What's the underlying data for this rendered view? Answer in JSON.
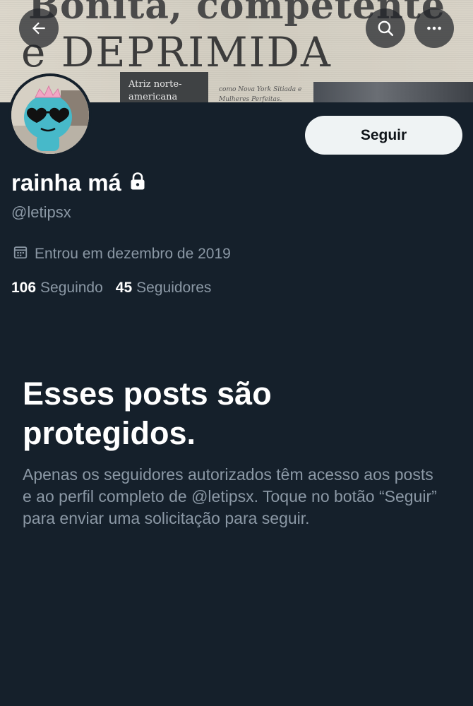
{
  "banner": {
    "headline_line1": "Bonita, competente",
    "headline_line2": "e DEPRIMIDA",
    "caption": "Atriz norte-americana",
    "article_snippet": "como Nova York Sitiada e Mulheres Perfeitas. Também escritora,"
  },
  "profile": {
    "follow_label": "Seguir",
    "display_name": "rainha má",
    "handle": "@letipsx",
    "joined": "Entrou em dezembro de 2019",
    "following_count": "106",
    "following_label": "Seguindo",
    "followers_count": "45",
    "followers_label": "Seguidores"
  },
  "protected": {
    "title": "Esses posts são protegidos.",
    "body": "Apenas os seguidores autorizados têm acesso aos posts e ao perfil completo de @letipsx. Toque no botão “Seguir” para enviar uma solicitação para seguir."
  },
  "icons": {
    "back": "arrow-left-icon",
    "search": "search-icon",
    "more": "more-horizontal-icon",
    "lock": "lock-icon",
    "calendar": "calendar-icon"
  }
}
